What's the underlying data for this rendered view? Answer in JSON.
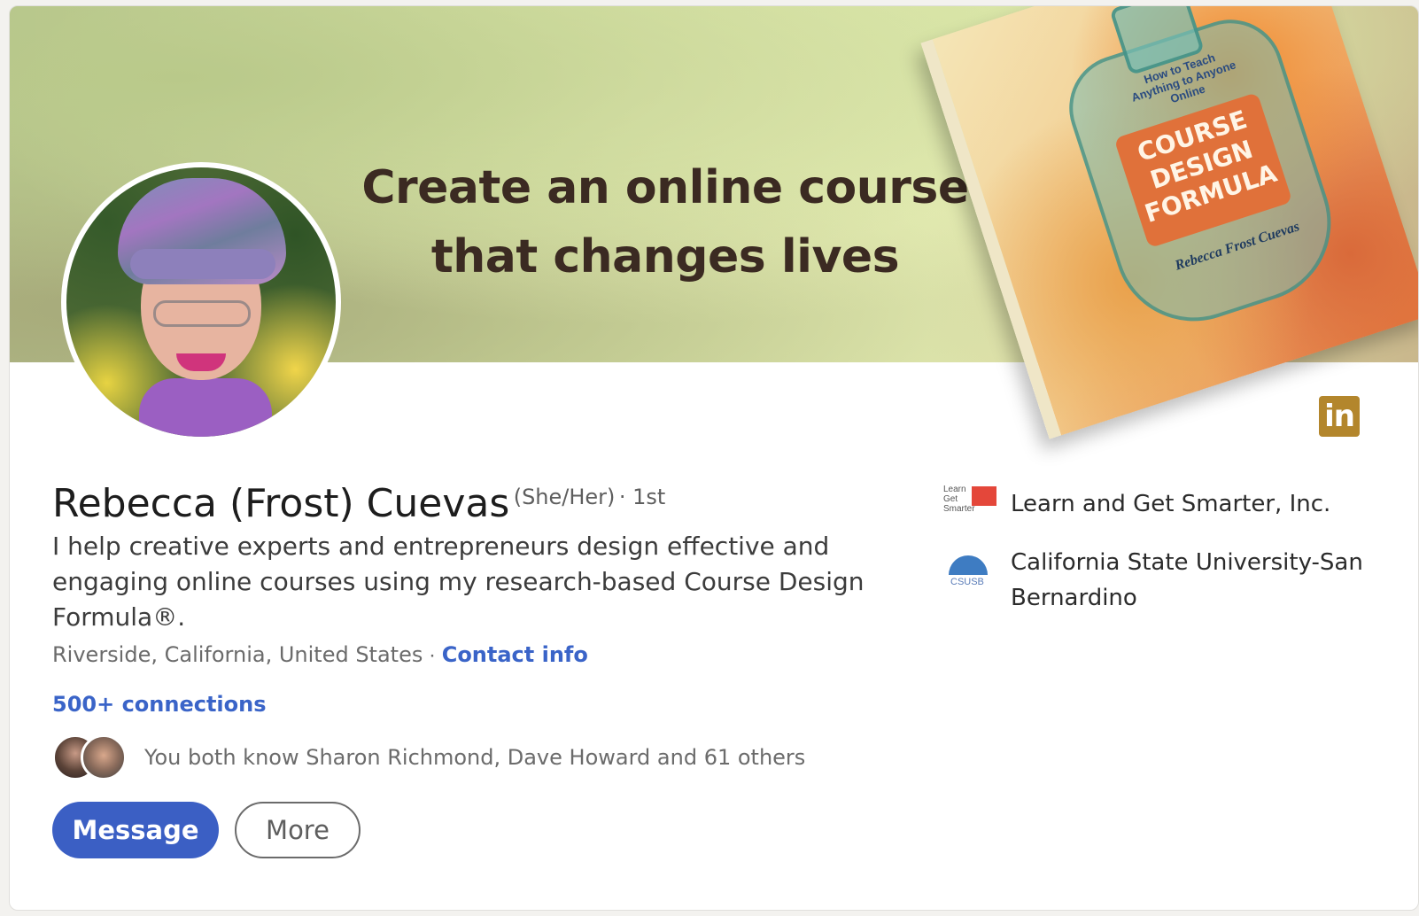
{
  "banner": {
    "headline_line1": "Create an online course",
    "headline_line2": "that changes lives",
    "book_tag": "How to Teach Anything to Anyone Online",
    "book_title": "COURSE DESIGN FORMULA",
    "book_author": "Rebecca Frost Cuevas"
  },
  "profile": {
    "name": "Rebecca (Frost) Cuevas",
    "pronouns": "(She/Her)",
    "degree": "· 1st",
    "headline": "I help creative experts and entrepreneurs design effective and engaging online courses using my research-based Course Design Formula®.",
    "location": "Riverside, California, United States",
    "location_separator": "·",
    "contact_info": "Contact info",
    "connections": "500+ connections",
    "mutual": "You both know Sharon Richmond, Dave Howard and 61 others"
  },
  "actions": {
    "message": "Message",
    "more": "More"
  },
  "experience": {
    "company_logo_text": "Learn Get Smarter",
    "company": "Learn and Get Smarter, Inc.",
    "school_logo_text": "CSUSB",
    "school": "California State University-San Bernardino"
  },
  "icons": {
    "linkedin_badge": "in"
  },
  "colors": {
    "primary": "#3b5fc4",
    "link": "#3a64c8",
    "linkedin_gold": "#b3862c"
  }
}
